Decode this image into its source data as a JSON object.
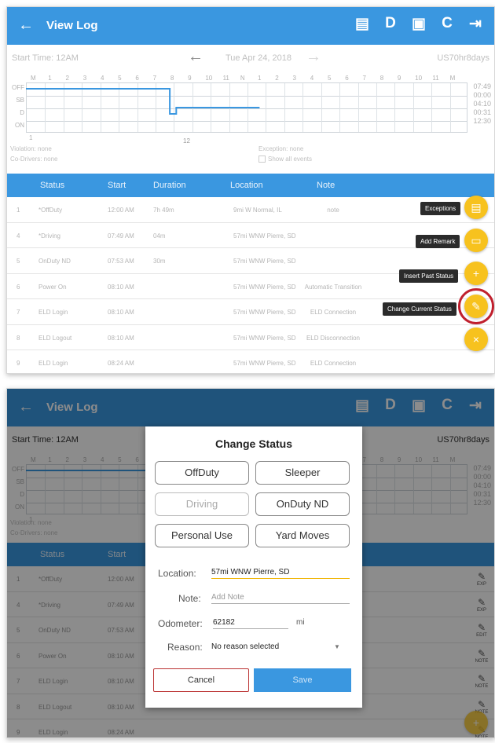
{
  "appbar": {
    "back_icon": "arrow-left-icon",
    "title": "View Log",
    "icons": [
      "message-icon",
      "D",
      "eld-device-icon",
      "refresh-icon",
      "logout-icon"
    ],
    "icon_glyphs": [
      "▤",
      "D",
      "▣",
      "C",
      "⇥"
    ]
  },
  "datebar": {
    "start_time": "Start Time: 12AM",
    "date": "Tue Apr 24, 2018",
    "cycle": "US70hr8days"
  },
  "graph": {
    "hours": [
      "M",
      "1",
      "2",
      "3",
      "4",
      "5",
      "6",
      "7",
      "8",
      "9",
      "10",
      "11",
      "N",
      "1",
      "2",
      "3",
      "4",
      "5",
      "6",
      "7",
      "8",
      "9",
      "10",
      "11",
      "M"
    ],
    "rows": [
      "OFF",
      "SB",
      "D",
      "ON"
    ],
    "totals": [
      "07:49",
      "00:00",
      "04:10",
      "00:31",
      "12:30"
    ],
    "marker": "12"
  },
  "meta": {
    "violation": "Violation: none",
    "codrivers": "Co-Drivers: none",
    "exception": "Exception: none",
    "show_all": "Show all events"
  },
  "table": {
    "headers": [
      "Status",
      "Start",
      "Duration",
      "Location",
      "Note"
    ],
    "rows": [
      {
        "n": "1",
        "status": "*OffDuty",
        "start": "12:00 AM",
        "duration": "7h 49m",
        "location": "9mi W Normal, IL",
        "note": "note",
        "action": "EXP"
      },
      {
        "n": "4",
        "status": "*Driving",
        "start": "07:49 AM",
        "duration": "04m",
        "location": "57mi WNW Pierre, SD",
        "note": "",
        "action": "EXP"
      },
      {
        "n": "5",
        "status": "OnDuty ND",
        "start": "07:53 AM",
        "duration": "30m",
        "location": "57mi WNW Pierre, SD",
        "note": "",
        "action": "EDIT"
      },
      {
        "n": "6",
        "status": "Power On",
        "start": "08:10 AM",
        "duration": "",
        "location": "57mi WNW Pierre, SD",
        "note": "Automatic Transition",
        "action": "NOTE"
      },
      {
        "n": "7",
        "status": "ELD Login",
        "start": "08:10 AM",
        "duration": "",
        "location": "57mi WNW Pierre, SD",
        "note": "ELD Connection",
        "action": "NOTE"
      },
      {
        "n": "8",
        "status": "ELD Logout",
        "start": "08:10 AM",
        "duration": "",
        "location": "57mi WNW Pierre, SD",
        "note": "ELD Disconnection",
        "action": "NOTE"
      },
      {
        "n": "9",
        "status": "ELD Login",
        "start": "08:24 AM",
        "duration": "",
        "location": "57mi WNW Pierre, SD",
        "note": "ELD Connection",
        "action": "NOTE"
      }
    ]
  },
  "fab_menu": {
    "exceptions": "Exceptions",
    "add_remark": "Add Remark",
    "insert_past": "Insert Past Status",
    "change_current": "Change Current Status",
    "colors": {
      "fab": "#f7c21e",
      "highlight": "#c0202e"
    }
  },
  "dialog": {
    "title": "Change Status",
    "buttons": [
      "OffDuty",
      "Sleeper",
      "Driving",
      "OnDuty ND",
      "Personal Use",
      "Yard Moves"
    ],
    "location_label": "Location:",
    "location_value": "57mi WNW Pierre, SD",
    "note_label": "Note:",
    "note_placeholder": "Add Note",
    "odometer_label": "Odometer:",
    "odometer_value": "62182",
    "odometer_unit": "mi",
    "reason_label": "Reason:",
    "reason_value": "No reason selected",
    "cancel": "Cancel",
    "save": "Save"
  },
  "row_actions": {
    "exp": "EXP",
    "edit": "EDIT",
    "note": "NOTE"
  },
  "colors": {
    "primary": "#3a97e0",
    "accent": "#f7c21e"
  }
}
